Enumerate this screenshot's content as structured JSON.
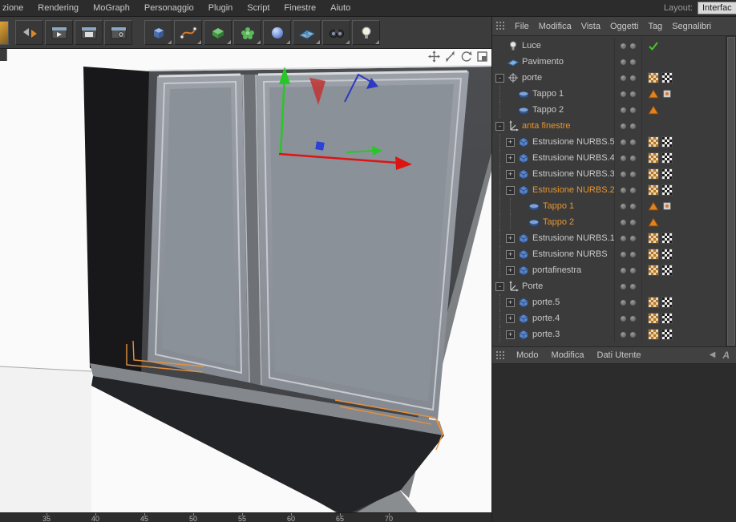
{
  "menubar": {
    "items": [
      "zione",
      "Rendering",
      "MoGraph",
      "Personaggio",
      "Plugin",
      "Script",
      "Finestre",
      "Aiuto"
    ],
    "layout_label": "Layout:",
    "layout_value": "Interfac"
  },
  "toolbar": {
    "groups": [
      [
        "undo-redo",
        "render-view",
        "render-picture-viewer",
        "render-settings"
      ],
      [
        "primitive-cube",
        "spline",
        "generator",
        "mograph",
        "metaball",
        "floor",
        "camera",
        "light"
      ]
    ]
  },
  "viewport": {
    "nav_icons": [
      "pan-camera",
      "zoom-camera",
      "orbit-camera",
      "toggle-view"
    ],
    "axis_colors": {
      "x": "#dd1414",
      "y": "#25c825",
      "z": "#2b41d8"
    },
    "selection_color": "#e8913a"
  },
  "timeline": {
    "ticks": [
      "35",
      "40",
      "45",
      "50",
      "55",
      "60",
      "65",
      "70"
    ]
  },
  "object_manager": {
    "grid_icon": "panel-grid",
    "menu_items": [
      "File",
      "Modifica",
      "Vista",
      "Oggetti",
      "Tag",
      "Segnalibri"
    ],
    "rows": [
      {
        "label": "Luce",
        "indent": 0,
        "icon": "light-object",
        "expander": null,
        "selected": false,
        "tags": [
          "check"
        ]
      },
      {
        "label": "Pavimento",
        "indent": 0,
        "icon": "floor-object",
        "expander": null,
        "selected": false,
        "tags": []
      },
      {
        "label": "porte",
        "indent": 0,
        "icon": "null-object",
        "expander": "minus",
        "selected": false,
        "tags": [
          "checker-brown",
          "checker"
        ]
      },
      {
        "label": "Tappo 1",
        "indent": 1,
        "icon": "cap-object",
        "expander": null,
        "selected": false,
        "tags": [
          "phong",
          "chip"
        ]
      },
      {
        "label": "Tappo 2",
        "indent": 1,
        "icon": "cap-object",
        "expander": null,
        "selected": false,
        "tags": [
          "phong"
        ]
      },
      {
        "label": "anta finestre",
        "indent": 0,
        "icon": "null-axes",
        "expander": "minus",
        "selected": true,
        "tags": []
      },
      {
        "label": "Estrusione NURBS.5",
        "indent": 1,
        "icon": "extrude-object",
        "expander": "plus",
        "selected": false,
        "tags": [
          "checker-brown",
          "checker"
        ]
      },
      {
        "label": "Estrusione NURBS.4",
        "indent": 1,
        "icon": "extrude-object",
        "expander": "plus",
        "selected": false,
        "tags": [
          "checker-brown",
          "checker"
        ]
      },
      {
        "label": "Estrusione NURBS.3",
        "indent": 1,
        "icon": "extrude-object",
        "expander": "plus",
        "selected": false,
        "tags": [
          "checker-brown",
          "checker"
        ]
      },
      {
        "label": "Estrusione NURBS.2",
        "indent": 1,
        "icon": "extrude-object",
        "expander": "minus",
        "selected": true,
        "tags": [
          "checker-brown",
          "checker"
        ]
      },
      {
        "label": "Tappo 1",
        "indent": 2,
        "icon": "cap-object",
        "expander": null,
        "selected": true,
        "tags": [
          "phong",
          "chip"
        ]
      },
      {
        "label": "Tappo 2",
        "indent": 2,
        "icon": "cap-object",
        "expander": null,
        "selected": true,
        "tags": [
          "phong"
        ]
      },
      {
        "label": "Estrusione NURBS.1",
        "indent": 1,
        "icon": "extrude-object",
        "expander": "plus",
        "selected": false,
        "tags": [
          "checker-brown",
          "checker"
        ]
      },
      {
        "label": "Estrusione NURBS",
        "indent": 1,
        "icon": "extrude-object",
        "expander": "plus",
        "selected": false,
        "tags": [
          "checker-brown",
          "checker"
        ]
      },
      {
        "label": "portafinestra",
        "indent": 1,
        "icon": "extrude-object",
        "expander": "plus",
        "selected": false,
        "tags": [
          "checker-brown",
          "checker"
        ]
      },
      {
        "label": "Porte",
        "indent": 0,
        "icon": "null-axes",
        "expander": "minus",
        "selected": false,
        "tags": []
      },
      {
        "label": "porte.5",
        "indent": 1,
        "icon": "extrude-object",
        "expander": "plus",
        "selected": false,
        "tags": [
          "checker-brown",
          "checker"
        ]
      },
      {
        "label": "porte.4",
        "indent": 1,
        "icon": "extrude-object",
        "expander": "plus",
        "selected": false,
        "tags": [
          "checker-brown",
          "checker"
        ]
      },
      {
        "label": "porte.3",
        "indent": 1,
        "icon": "extrude-object",
        "expander": "plus",
        "selected": false,
        "tags": [
          "checker-brown",
          "checker"
        ]
      }
    ]
  },
  "attribute_manager": {
    "grid_icon": "panel-grid",
    "tabs": [
      "Modo",
      "Modifica",
      "Dati Utente"
    ],
    "right_icons": [
      "back-arrow",
      "a-badge"
    ]
  }
}
